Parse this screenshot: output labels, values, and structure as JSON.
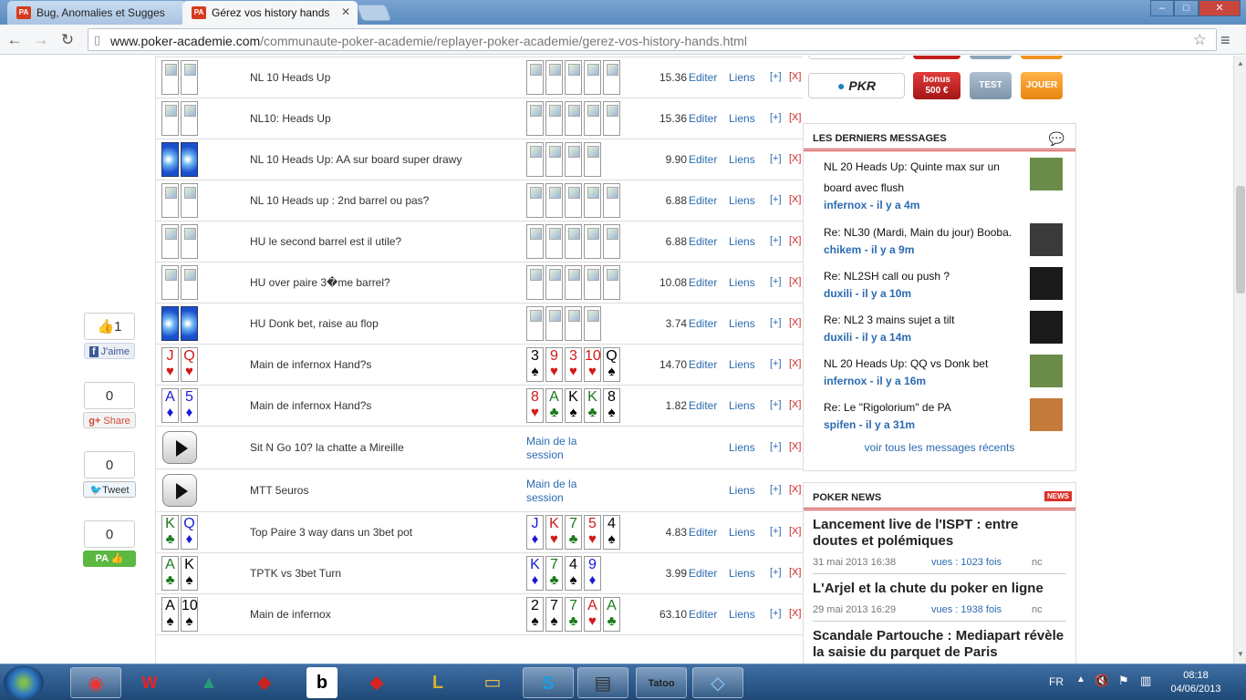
{
  "browser": {
    "tabs": [
      {
        "label": "Bug, Anomalies et Sugges",
        "active": false
      },
      {
        "label": "Gérez vos history hands",
        "active": true
      }
    ],
    "url_domain": "www.poker-academie.com",
    "url_path": "/communaute-poker-academie/replayer-poker-academie/gerez-vos-history-hands.html",
    "window": {
      "minimize": "–",
      "maximize": "□",
      "close": "✕"
    }
  },
  "social": {
    "like_count": "1",
    "like_label": "J'aime",
    "share_count": "0",
    "share_label": "Share",
    "tweet_count": "0",
    "tweet_label": "Tweet",
    "pa_count": "0",
    "pa_label": "PA"
  },
  "hands": [
    {
      "title": "NL 10 Heads Up",
      "amount": "15.36"
    },
    {
      "title": "NL10: Heads Up",
      "amount": "15.36"
    },
    {
      "title": "NL 10 Heads Up: AA sur board super drawy",
      "amount": "9.90"
    },
    {
      "title": "NL 10 Heads up : 2nd barrel ou pas?",
      "amount": "6.88"
    },
    {
      "title": "HU le second barrel est il utile?",
      "amount": "6.88"
    },
    {
      "title": "HU over paire 3�me barrel?",
      "amount": "10.08"
    },
    {
      "title": "HU Donk bet, raise au flop",
      "amount": "3.74"
    },
    {
      "title": "Main de infernox Hand?s",
      "amount": "14.70"
    },
    {
      "title": "Main de infernox Hand?s",
      "amount": "1.82"
    },
    {
      "title": "Sit N Go 10? la chatte a Mireille",
      "session": "Main de la session"
    },
    {
      "title": "MTT 5euros",
      "session": "Main de la session"
    },
    {
      "title": "Top Paire 3 way dans un 3bet pot",
      "amount": "4.83"
    },
    {
      "title": "TPTK vs 3bet Turn",
      "amount": "3.99"
    },
    {
      "title": "Main de infernox",
      "amount": "63.10"
    }
  ],
  "actions": {
    "edit": "Editer",
    "links": "Liens",
    "plus": "[+]",
    "delete": "[X]"
  },
  "promo": {
    "bonus_line1": "bonus",
    "bonus_line2": "500 €",
    "test": "TEST",
    "play": "JOUER",
    "pkr": "PKR"
  },
  "messages_box": {
    "title": "LES DERNIERS MESSAGES",
    "items": [
      {
        "title": "NL 20 Heads Up: Quinte max sur un board avec flush",
        "author": "infernox - il y a 4m"
      },
      {
        "title": "Re: NL30 (Mardi, Main du jour) Booba.",
        "author": "chikem - il y a 9m"
      },
      {
        "title": "Re: NL2SH call ou push ?",
        "author": "duxili - il y a 10m"
      },
      {
        "title": "Re: NL2 3 mains sujet a tilt",
        "author": "duxili - il y a 14m"
      },
      {
        "title": "NL 20 Heads Up: QQ vs Donk bet",
        "author": "infernox - il y a 16m"
      },
      {
        "title": "Re: Le \"Rigolorium\" de PA",
        "author": "spifen - il y a 31m"
      }
    ],
    "see_all": "voir tous les messages récents"
  },
  "news_box": {
    "title": "POKER NEWS",
    "badge": "NEWS",
    "items": [
      {
        "title": "Lancement live de l'ISPT : entre doutes et polémiques",
        "date": "31 mai 2013 16:38",
        "views": "vues : 1023 fois",
        "comments": "nc"
      },
      {
        "title": "L'Arjel et la chute du poker en ligne",
        "date": "29 mai 2013 16:29",
        "views": "vues : 1938 fois",
        "comments": "nc"
      },
      {
        "title": "Scandale Partouche : Mediapart révèle la saisie du parquet de Paris",
        "date": "",
        "views": "",
        "comments": ""
      }
    ]
  },
  "taskbar": {
    "lang": "FR",
    "time": "08:18",
    "date": "04/06/2013"
  }
}
